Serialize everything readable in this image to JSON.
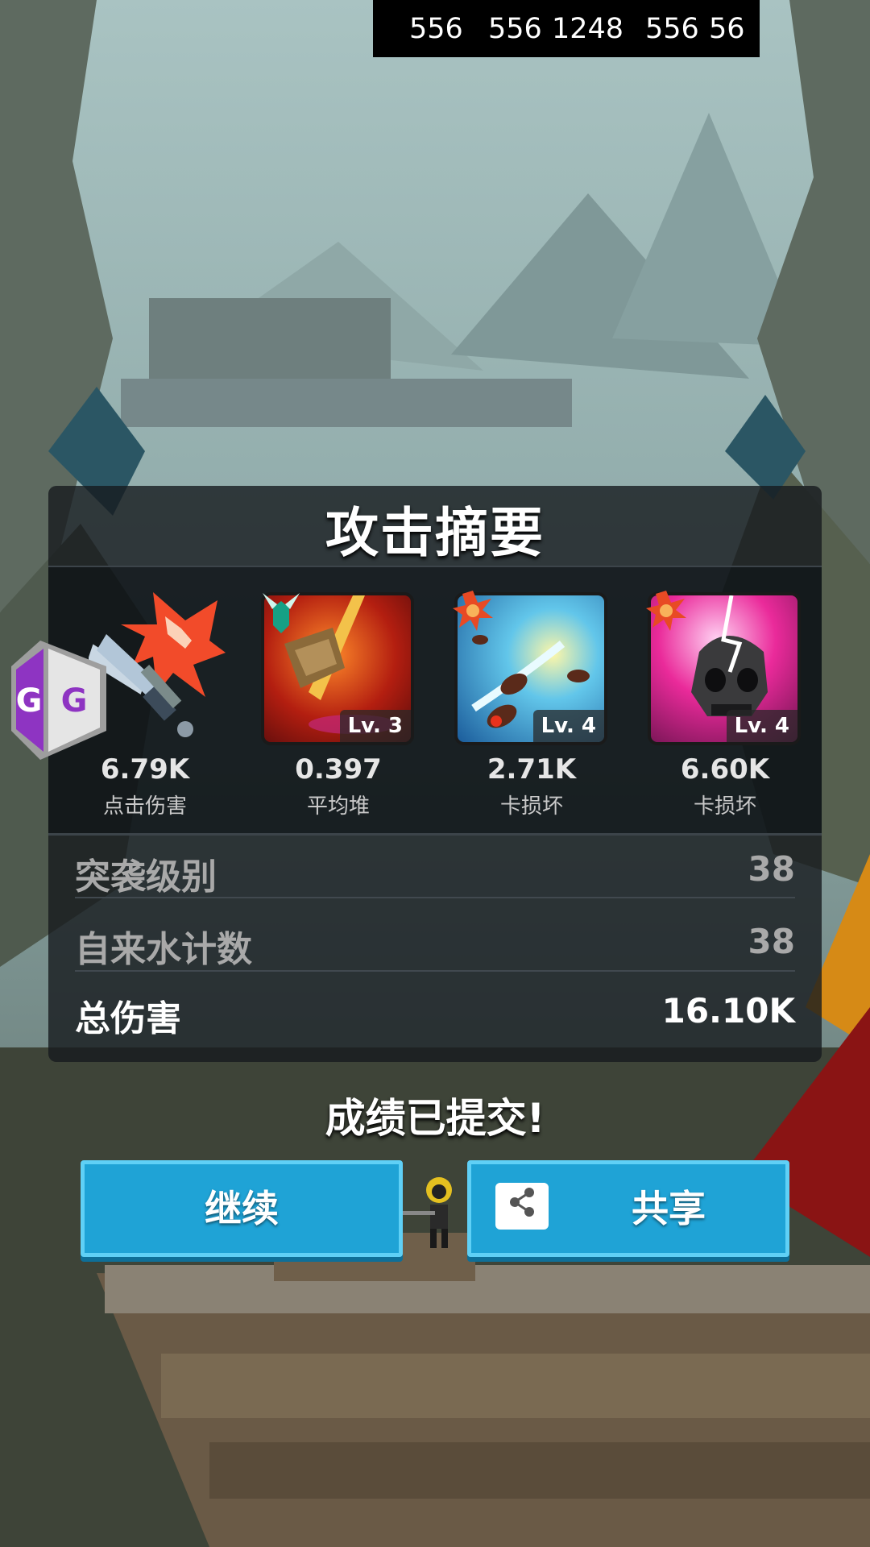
{
  "status_overlay": {
    "values": [
      "556",
      "556",
      "1248",
      "556",
      "56"
    ]
  },
  "summary": {
    "title": "攻击摘要",
    "stats": [
      {
        "value": "6.79K",
        "label": "点击伤害",
        "icon": "sword-icon"
      },
      {
        "value": "0.397",
        "label": "平均堆",
        "icon": "hammer-skill-icon",
        "level": "Lv. 3"
      },
      {
        "value": "2.71K",
        "label": "卡损坏",
        "icon": "missile-skill-icon",
        "level": "Lv. 4"
      },
      {
        "value": "6.60K",
        "label": "卡损坏",
        "icon": "skull-skill-icon",
        "level": "Lv. 4"
      }
    ],
    "rows": [
      {
        "label": "突袭级别",
        "value": "38"
      },
      {
        "label": "自来水计数",
        "value": "38"
      },
      {
        "label": "总伤害",
        "value": "16.10K"
      }
    ]
  },
  "submitted_text": "成绩已提交!",
  "buttons": {
    "continue": "继续",
    "share": "共享"
  },
  "overlay_badge": {
    "letters": [
      "G",
      "G"
    ]
  },
  "colors": {
    "button": "#1fa3d6",
    "button_border": "#5fd0f6",
    "panel": "#16191d"
  }
}
